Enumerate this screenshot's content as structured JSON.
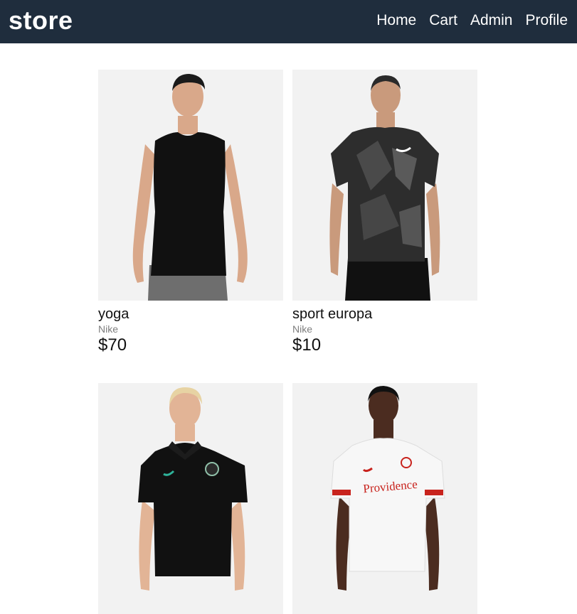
{
  "header": {
    "brand": "store",
    "nav": [
      {
        "label": "Home"
      },
      {
        "label": "Cart"
      },
      {
        "label": "Admin"
      },
      {
        "label": "Profile"
      }
    ]
  },
  "products": [
    {
      "title": "yoga",
      "brand": "Nike",
      "price": "$70",
      "image": "black-sleeveless-tank-photo"
    },
    {
      "title": "sport europa",
      "brand": "Nike",
      "price": "$10",
      "image": "camo-sport-tshirt-photo"
    },
    {
      "title": "",
      "brand": "",
      "price": "",
      "image": "black-polo-shirt-photo"
    },
    {
      "title": "",
      "brand": "",
      "price": "",
      "image": "white-providence-jersey-photo",
      "jersey_text": "Providence"
    }
  ]
}
